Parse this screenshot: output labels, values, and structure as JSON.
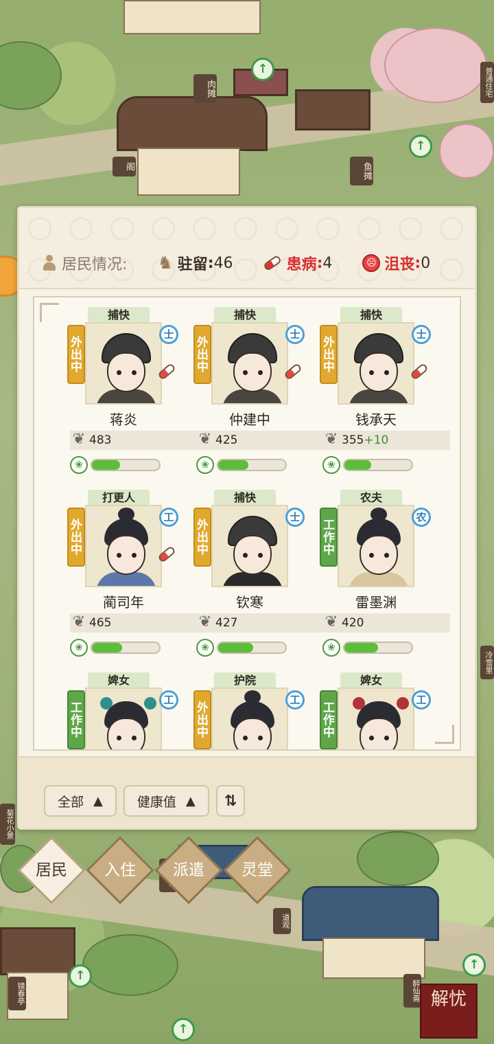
{
  "map": {
    "signs": [
      "肉摊",
      "阁",
      "鱼摊",
      "普通住宅",
      "冷雪里",
      "菊花小景",
      "鞠燕馆",
      "道观",
      "镜春亭",
      "醉仙斋"
    ],
    "up_badge_symbol": "↑"
  },
  "panel": {
    "residents_label": "居民情况:",
    "stats": {
      "stay": {
        "label": "驻留",
        "value": "46"
      },
      "sick": {
        "label": "患病",
        "value": "4"
      },
      "sad": {
        "label": "沮丧",
        "value": "0"
      }
    },
    "residents": [
      {
        "role": "捕快",
        "status": "外出中",
        "rank": "士",
        "sick": true,
        "name": "蒋炎",
        "hp": "483",
        "hp_bonus": "",
        "vitality": 0.42
      },
      {
        "role": "捕快",
        "status": "外出中",
        "rank": "士",
        "sick": true,
        "name": "仲建中",
        "hp": "425",
        "hp_bonus": "",
        "vitality": 0.45
      },
      {
        "role": "捕快",
        "status": "外出中",
        "rank": "士",
        "sick": true,
        "name": "钱承天",
        "hp": "355",
        "hp_bonus": "+10",
        "vitality": 0.4
      },
      {
        "role": "打更人",
        "status": "外出中",
        "rank": "工",
        "sick": true,
        "name": "蔺司年",
        "hp": "465",
        "hp_bonus": "",
        "vitality": 0.45
      },
      {
        "role": "捕快",
        "status": "外出中",
        "rank": "士",
        "sick": false,
        "name": "钦寒",
        "hp": "427",
        "hp_bonus": "",
        "vitality": 0.52
      },
      {
        "role": "农夫",
        "status": "工作中",
        "rank": "农",
        "sick": false,
        "name": "雷墨渊",
        "hp": "420",
        "hp_bonus": "",
        "vitality": 0.5
      },
      {
        "role": "婢女",
        "status": "工作中",
        "rank": "工",
        "sick": false,
        "name": "",
        "hp": "",
        "hp_bonus": "",
        "vitality": 0
      },
      {
        "role": "护院",
        "status": "外出中",
        "rank": "工",
        "sick": false,
        "name": "",
        "hp": "",
        "hp_bonus": "",
        "vitality": 0
      },
      {
        "role": "婢女",
        "status": "工作中",
        "rank": "工",
        "sick": false,
        "name": "",
        "hp": "",
        "hp_bonus": "",
        "vitality": 0
      }
    ],
    "filters": {
      "all": "全部",
      "health": "健康值",
      "sort_icon": "⇅"
    }
  },
  "nav": {
    "tabs": [
      {
        "label": "居民",
        "active": true
      },
      {
        "label": "入住",
        "active": false
      },
      {
        "label": "派遣",
        "active": false
      },
      {
        "label": "灵堂",
        "active": false
      }
    ]
  },
  "stamp": {
    "text": "解忧"
  },
  "colors": {
    "accent_green": "#5cbd3a",
    "sick_red": "#d62d2d",
    "out_tag": "#e0a92e",
    "work_tag": "#5fa64b"
  }
}
